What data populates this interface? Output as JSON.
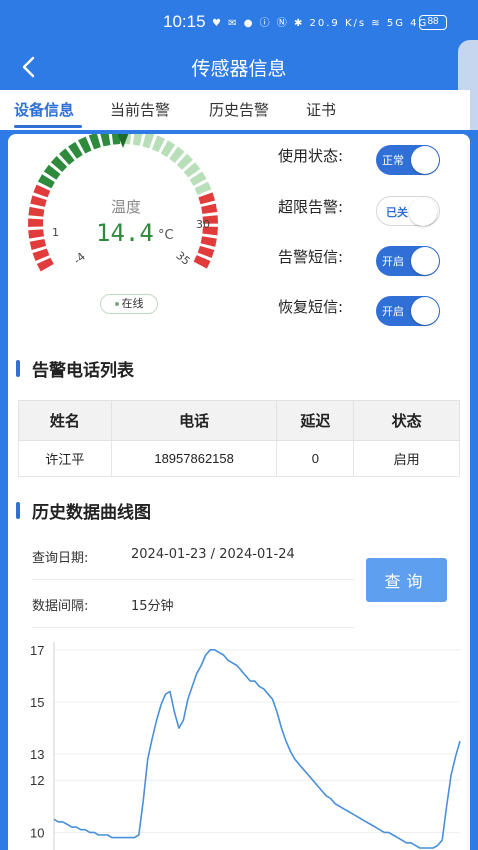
{
  "status_bar": {
    "time": "10:15",
    "icons_text": "♥ ✉ ● ⓘ Ⓝ ✱ 20.9 K/s ≋ 5G 4G",
    "battery": "88"
  },
  "navbar": {
    "title": "传感器信息",
    "back_icon": "chevron-left-icon"
  },
  "tabs": [
    {
      "label": "设备信息",
      "active": true
    },
    {
      "label": "当前告警",
      "active": false
    },
    {
      "label": "历史告警",
      "active": false
    },
    {
      "label": "证书",
      "active": false
    }
  ],
  "gauge": {
    "label": "温度",
    "value": "14.4",
    "unit": "°C",
    "ticks": {
      "t1": "1",
      "tm4": "-4",
      "t30": "30",
      "t35": "35"
    },
    "reading_fraction": 0.5,
    "online_label": "在线",
    "colors": {
      "green": "#2e8b3e",
      "light_green": "#b8dfb9",
      "red": "#e23b3b",
      "value": "#2e8b3e"
    }
  },
  "settings": [
    {
      "label": "使用状态:",
      "state_text": "正常",
      "on": true
    },
    {
      "label": "超限告警:",
      "state_text": "已关",
      "on": false
    },
    {
      "label": "告警短信:",
      "state_text": "开启",
      "on": true
    },
    {
      "label": "恢复短信:",
      "state_text": "开启",
      "on": true
    }
  ],
  "phone_list": {
    "title": "告警电话列表",
    "headers": [
      "姓名",
      "电话",
      "延迟",
      "状态"
    ],
    "rows": [
      [
        "许江平",
        "18957862158",
        "0",
        "启用"
      ]
    ]
  },
  "history": {
    "title": "历史数据曲线图",
    "date_label": "查询日期:",
    "date_value": "2024-01-23 / 2024-01-24",
    "interval_label": "数据间隔:",
    "interval_value": "15分钟",
    "query_button": "查询"
  },
  "chart_data": {
    "type": "line",
    "title": "",
    "xlabel": "",
    "ylabel": "",
    "y_ticks": [
      "17",
      "15",
      "13",
      "12",
      "10"
    ],
    "y_tick_values": [
      17,
      15,
      13,
      12,
      10
    ],
    "ylim": [
      9.4,
      17.3
    ],
    "grid": true,
    "color": "#4a90d9",
    "series": [
      {
        "values": [
          10.5,
          10.4,
          10.4,
          10.3,
          10.2,
          10.2,
          10.1,
          10.1,
          10.0,
          10.0,
          9.9,
          9.9,
          9.9,
          9.8,
          9.8,
          9.8,
          9.8,
          9.8,
          9.8,
          9.9,
          11.2,
          12.8,
          13.6,
          14.3,
          14.9,
          15.3,
          15.4,
          14.6,
          14.0,
          14.3,
          15.1,
          15.6,
          16.1,
          16.4,
          16.8,
          17.0,
          17.0,
          16.9,
          16.8,
          16.6,
          16.5,
          16.4,
          16.2,
          16.0,
          15.8,
          15.8,
          15.6,
          15.5,
          15.3,
          15.1,
          14.6,
          14.0,
          13.5,
          13.1,
          12.8,
          12.6,
          12.4,
          12.2,
          12.0,
          11.8,
          11.6,
          11.4,
          11.3,
          11.1,
          11.0,
          10.9,
          10.8,
          10.7,
          10.6,
          10.5,
          10.4,
          10.3,
          10.2,
          10.1,
          10.0,
          10.0,
          9.9,
          9.8,
          9.7,
          9.6,
          9.6,
          9.5,
          9.4,
          9.4,
          9.4,
          9.4,
          9.5,
          9.7,
          11.0,
          12.2,
          12.9,
          13.5
        ]
      }
    ]
  }
}
